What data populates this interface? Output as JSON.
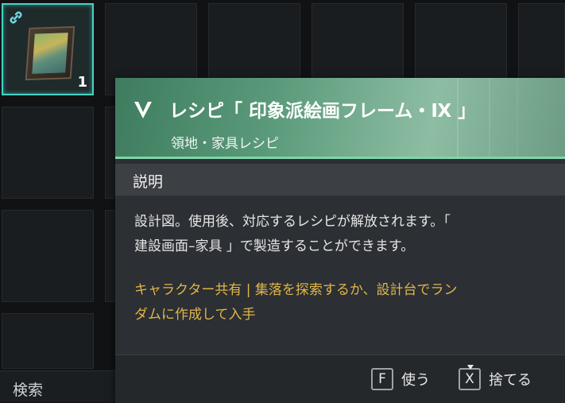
{
  "inventory": {
    "selected_item": {
      "quantity": "1",
      "icon": "painting-frame-icon",
      "badge_icon": "link-icon"
    }
  },
  "search": {
    "label": "検索"
  },
  "tooltip": {
    "rank_icon": "chevron-rank-icon",
    "title": "レシピ「 印象派絵画フレーム・Ⅸ 」",
    "subtitle": "領地・家具レシピ",
    "section_label": "説明",
    "description_lines": [
      "設計図。使用後、対応するレシピが解放されます。「",
      "建設画面–家具 」で製造することができます。"
    ],
    "source_lines": [
      "キャラクター共有 | 集落を探索するか、設計台でラン",
      "ダムに作成して入手"
    ],
    "actions": {
      "use": {
        "key": "F",
        "label": "使う"
      },
      "discard": {
        "key": "X",
        "label": "捨てる"
      }
    }
  },
  "colors": {
    "accent": "#46d3c6",
    "header_green": "#5a9a7a",
    "source_text": "#e0b64a",
    "panel_bg": "#2c2f33"
  }
}
